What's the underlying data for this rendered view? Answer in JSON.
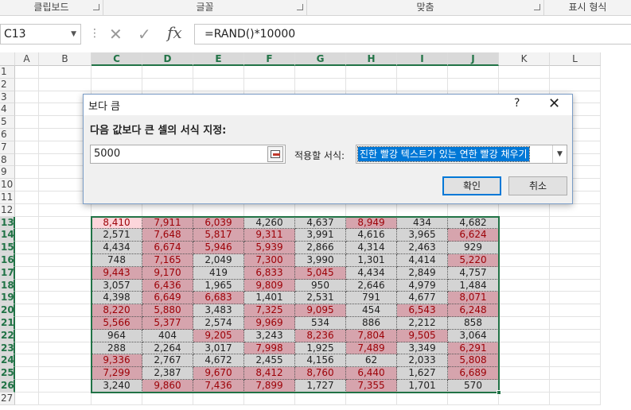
{
  "ribbon": {
    "groups": [
      "클립보드",
      "글꼴",
      "맞춤",
      "표시 형식"
    ]
  },
  "formula_bar": {
    "name_box": "C13",
    "fx_label": "fx",
    "formula": "=RAND()*10000"
  },
  "sheet": {
    "columns": [
      "A",
      "B",
      "C",
      "D",
      "E",
      "F",
      "G",
      "H",
      "I",
      "J",
      "K",
      "L"
    ],
    "rows": [
      "1",
      "2",
      "3",
      "4",
      "5",
      "6",
      "7",
      "8",
      "9",
      "10",
      "11",
      "12",
      "13",
      "14",
      "15",
      "16",
      "17",
      "18",
      "19",
      "20",
      "21",
      "22",
      "23",
      "24",
      "25",
      "26",
      "27"
    ],
    "data_rows": [
      [
        "8,410",
        "7,911",
        "6,039",
        "4,260",
        "4,637",
        "8,949",
        "434",
        "4,682"
      ],
      [
        "2,571",
        "7,648",
        "5,817",
        "9,311",
        "3,991",
        "4,616",
        "3,965",
        "6,624"
      ],
      [
        "4,434",
        "6,674",
        "5,946",
        "5,939",
        "2,866",
        "4,314",
        "2,463",
        "929"
      ],
      [
        "748",
        "7,165",
        "2,049",
        "7,300",
        "3,990",
        "1,301",
        "4,414",
        "5,220"
      ],
      [
        "9,443",
        "9,170",
        "419",
        "6,833",
        "5,045",
        "4,434",
        "2,849",
        "4,757"
      ],
      [
        "3,057",
        "6,436",
        "1,965",
        "9,809",
        "950",
        "2,646",
        "4,979",
        "1,484"
      ],
      [
        "4,398",
        "6,649",
        "6,683",
        "1,401",
        "2,531",
        "791",
        "4,677",
        "8,071"
      ],
      [
        "8,220",
        "5,880",
        "3,483",
        "7,325",
        "9,095",
        "454",
        "6,543",
        "6,248"
      ],
      [
        "5,566",
        "5,377",
        "2,574",
        "9,969",
        "534",
        "886",
        "2,212",
        "858"
      ],
      [
        "964",
        "404",
        "9,205",
        "3,243",
        "8,236",
        "7,804",
        "9,505",
        "3,064"
      ],
      [
        "288",
        "2,264",
        "3,017",
        "7,998",
        "1,925",
        "7,489",
        "3,349",
        "6,291"
      ],
      [
        "9,336",
        "2,767",
        "4,672",
        "2,455",
        "4,156",
        "62",
        "2,033",
        "5,808"
      ],
      [
        "7,299",
        "2,387",
        "9,670",
        "8,412",
        "8,760",
        "6,440",
        "1,627",
        "6,689"
      ],
      [
        "3,240",
        "9,860",
        "7,436",
        "7,899",
        "1,727",
        "7,355",
        "1,701",
        "570"
      ]
    ],
    "colors": {
      "highlight_fill": "#d6a4ad",
      "highlight_text": "#9c0006",
      "normal_fill": "#d4d4d4",
      "accent": "#217346"
    }
  },
  "dialog": {
    "title": "보다 큼",
    "help": "?",
    "close": "✕",
    "prompt": "다음 값보다 큰 셀의 서식 지정:",
    "value": "5000",
    "apply_label": "적용할 서식:",
    "format_option": "진한 빨강 텍스트가 있는 연한 빨강 채우기",
    "ok_label": "확인",
    "cancel_label": "취소"
  }
}
